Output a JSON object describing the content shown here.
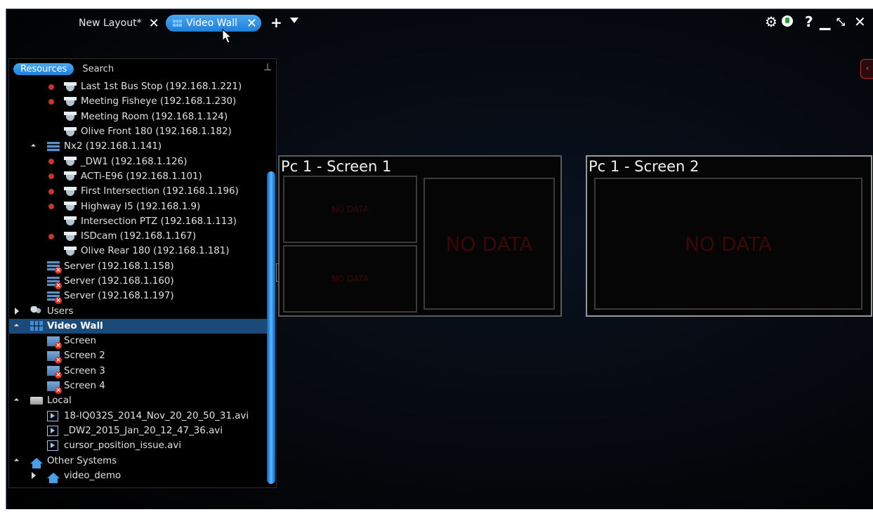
{
  "tabs": {
    "new_layout": "New Layout*",
    "video_wall": "Video Wall",
    "close_glyph": "✕",
    "add_glyph": "+"
  },
  "window_controls": {
    "help": "?",
    "minimize": "▁",
    "fullscreen": "⤡",
    "close": "✕",
    "settings": "⚙"
  },
  "panel": {
    "tab_resources": "Resources",
    "tab_search": "Search",
    "pin": "📌"
  },
  "tree": [
    {
      "label": "Last 1st Bus Stop (192.168.1.221)",
      "icon": "camera-icon",
      "status": "offline"
    },
    {
      "label": "Meeting Fisheye (192.168.1.230)",
      "icon": "camera-icon",
      "status": "offline"
    },
    {
      "label": "Meeting Room (192.168.1.124)",
      "icon": "camera-icon",
      "status": ""
    },
    {
      "label": "Olive Front 180 (192.168.1.182)",
      "icon": "camera-icon",
      "status": ""
    },
    {
      "label": "Nx2 (192.168.1.141)",
      "icon": "server-icon",
      "status": ""
    },
    {
      "label": "_DW1 (192.168.1.126)",
      "icon": "camera-icon",
      "status": "offline"
    },
    {
      "label": "ACTi-E96 (192.168.1.101)",
      "icon": "camera-icon",
      "status": "offline"
    },
    {
      "label": "First Intersection (192.168.1.196)",
      "icon": "camera-icon",
      "status": "offline"
    },
    {
      "label": "Highway I5 (192.168.1.9)",
      "icon": "camera-icon",
      "status": "offline"
    },
    {
      "label": "Intersection PTZ (192.168.1.113)",
      "icon": "camera-icon",
      "status": ""
    },
    {
      "label": "ISDcam (192.168.1.167)",
      "icon": "camera-icon",
      "status": "offline"
    },
    {
      "label": "Olive Rear 180 (192.168.1.181)",
      "icon": "camera-icon",
      "status": ""
    },
    {
      "label": "Server (192.168.1.158)",
      "icon": "server-offline-icon",
      "status": ""
    },
    {
      "label": "Server (192.168.1.160)",
      "icon": "server-offline-icon",
      "status": ""
    },
    {
      "label": "Server (192.168.1.197)",
      "icon": "server-offline-icon",
      "status": ""
    },
    {
      "label": "Users",
      "icon": "users-icon",
      "status": ""
    },
    {
      "label": "Video Wall",
      "icon": "video-wall-icon",
      "status": ""
    },
    {
      "label": "Screen",
      "icon": "screen-offline-icon",
      "status": ""
    },
    {
      "label": "Screen 2",
      "icon": "screen-offline-icon",
      "status": ""
    },
    {
      "label": "Screen 3",
      "icon": "screen-offline-icon",
      "status": ""
    },
    {
      "label": "Screen 4",
      "icon": "screen-offline-icon",
      "status": ""
    },
    {
      "label": "Local",
      "icon": "folder-icon",
      "status": ""
    },
    {
      "label": "18-IQ032S_2014_Nov_20_20_50_31.avi",
      "icon": "video-file-icon",
      "status": ""
    },
    {
      "label": "_DW2_2015_Jan_20_12_47_36.avi",
      "icon": "video-file-icon",
      "status": ""
    },
    {
      "label": "cursor_position_issue.avi",
      "icon": "video-file-icon",
      "status": ""
    },
    {
      "label": "Other Systems",
      "icon": "home-icon",
      "status": ""
    },
    {
      "label": "video_demo",
      "icon": "home-icon",
      "status": ""
    }
  ],
  "screens": [
    {
      "title": "Pc 1 - Screen 1",
      "cells": [
        "NO DATA",
        "NO DATA",
        "NO DATA"
      ]
    },
    {
      "title": "Pc 1 - Screen 2",
      "cells": [
        "NO DATA"
      ]
    }
  ],
  "colors": {
    "accent": "#1f7fd8",
    "selected_row": "#1c4a78",
    "offline_dot": "#c0392b",
    "no_data_text": "#3a0808"
  }
}
